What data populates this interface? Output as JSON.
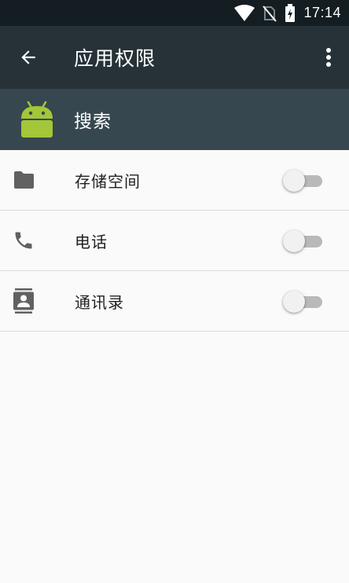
{
  "status_bar": {
    "time": "17:14",
    "icons": [
      "wifi-icon",
      "no-sim-icon",
      "battery-charging-icon"
    ]
  },
  "toolbar": {
    "title": "应用权限",
    "back_icon": "arrow-back-icon",
    "menu_icon": "more-vert-icon"
  },
  "app": {
    "name": "搜索",
    "icon": "android-robot-icon",
    "icon_color": "#a4c639"
  },
  "permissions": [
    {
      "label": "存储空间",
      "icon": "folder-icon",
      "enabled": false
    },
    {
      "label": "电话",
      "icon": "phone-icon",
      "enabled": false
    },
    {
      "label": "通讯录",
      "icon": "contacts-icon",
      "enabled": false
    }
  ],
  "colors": {
    "status_bar": "#141d21",
    "toolbar": "#263238",
    "app_header": "#37474f",
    "background": "#fafafa"
  }
}
